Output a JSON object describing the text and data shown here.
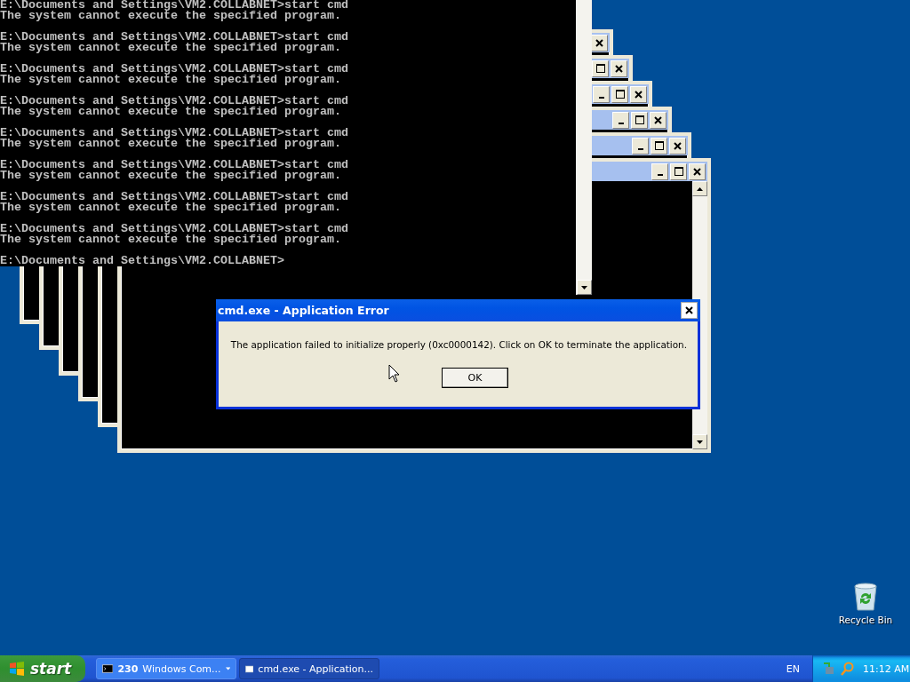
{
  "console": {
    "lines": [
      {
        "kind": "command",
        "text": "E:\\Documents and Settings\\VM2.COLLABNET>start cmd"
      },
      {
        "kind": "output",
        "text": "The system cannot execute the specified program."
      },
      {
        "kind": "command",
        "text": "E:\\Documents and Settings\\VM2.COLLABNET>start cmd"
      },
      {
        "kind": "output",
        "text": "The system cannot execute the specified program."
      },
      {
        "kind": "command",
        "text": "E:\\Documents and Settings\\VM2.COLLABNET>start cmd"
      },
      {
        "kind": "output",
        "text": "The system cannot execute the specified program."
      },
      {
        "kind": "command",
        "text": "E:\\Documents and Settings\\VM2.COLLABNET>start cmd"
      },
      {
        "kind": "output",
        "text": "The system cannot execute the specified program."
      },
      {
        "kind": "command",
        "text": "E:\\Documents and Settings\\VM2.COLLABNET>start cmd"
      },
      {
        "kind": "output",
        "text": "The system cannot execute the specified program."
      },
      {
        "kind": "command",
        "text": "E:\\Documents and Settings\\VM2.COLLABNET>start cmd"
      },
      {
        "kind": "output",
        "text": "The system cannot execute the specified program."
      },
      {
        "kind": "command",
        "text": "E:\\Documents and Settings\\VM2.COLLABNET>start cmd"
      },
      {
        "kind": "output",
        "text": "The system cannot execute the specified program."
      },
      {
        "kind": "command",
        "text": "E:\\Documents and Settings\\VM2.COLLABNET>start cmd"
      },
      {
        "kind": "output",
        "text": "The system cannot execute the specified program."
      },
      {
        "kind": "command",
        "text": "E:\\Documents and Settings\\VM2.COLLABNET>"
      }
    ]
  },
  "dialog": {
    "title": "cmd.exe - Application Error",
    "message": "The application failed to initialize properly (0xc0000142). Click on OK to terminate the application.",
    "buttons": [
      "OK"
    ]
  },
  "desktop_icons": [
    {
      "label": "Recycle Bin"
    }
  ],
  "taskbar": {
    "start": "start",
    "tasks": [
      {
        "kind": "group",
        "count": "230",
        "label": "Windows Com...",
        "selected": false
      },
      {
        "kind": "window",
        "label": "cmd.exe - Application...",
        "selected": true
      }
    ],
    "language": "EN",
    "clock": "11:12 AM"
  }
}
